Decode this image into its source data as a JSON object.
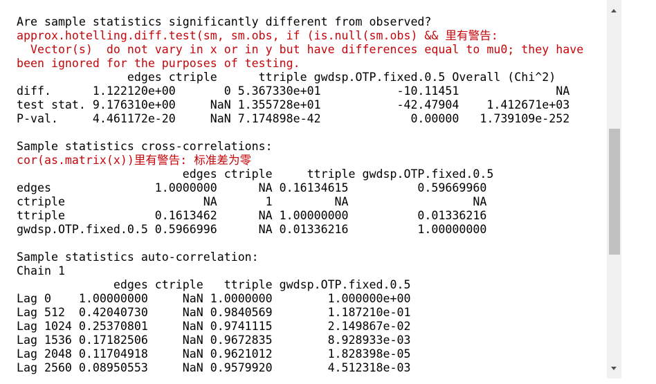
{
  "console": {
    "lines": [
      {
        "text": "Are sample statistics significantly different from observed?",
        "type": "output"
      },
      {
        "text": "approx.hotelling.diff.test(sm, sm.obs, if (is.null(sm.obs) && 里有警告:",
        "type": "error"
      },
      {
        "text": "  Vector(s)  do not vary in x or in y but have differences equal to mu0; they have",
        "type": "error"
      },
      {
        "text": "been ignored for the purposes of testing.",
        "type": "error"
      },
      {
        "text": "                edges ctriple      ttriple gwdsp.OTP.fixed.0.5 Overall (Chi^2)",
        "type": "output"
      },
      {
        "text": "diff.      1.122120e+00       0 5.367330e+01           -10.11451              NA",
        "type": "output"
      },
      {
        "text": "test stat. 9.176310e+00     NaN 1.355728e+01           -42.47904    1.412671e+03",
        "type": "output"
      },
      {
        "text": "P-val.     4.461172e-20     NaN 7.174898e-42             0.00000   1.739109e-252",
        "type": "output"
      },
      {
        "text": "",
        "type": "output"
      },
      {
        "text": "Sample statistics cross-correlations:",
        "type": "output"
      },
      {
        "text": "cor(as.matrix(x))里有警告: 标准差为零",
        "type": "error"
      },
      {
        "text": "                        edges ctriple     ttriple gwdsp.OTP.fixed.0.5",
        "type": "output"
      },
      {
        "text": "edges               1.0000000      NA 0.16134615          0.59669960",
        "type": "output"
      },
      {
        "text": "ctriple                    NA       1         NA                  NA",
        "type": "output"
      },
      {
        "text": "ttriple             0.1613462      NA 1.00000000          0.01336216",
        "type": "output"
      },
      {
        "text": "gwdsp.OTP.fixed.0.5 0.5966996      NA 0.01336216          1.00000000",
        "type": "output"
      },
      {
        "text": "",
        "type": "output"
      },
      {
        "text": "Sample statistics auto-correlation:",
        "type": "output"
      },
      {
        "text": "Chain 1",
        "type": "output"
      },
      {
        "text": "              edges ctriple   ttriple gwdsp.OTP.fixed.0.5",
        "type": "output"
      },
      {
        "text": "Lag 0    1.00000000     NaN 1.0000000        1.000000e+00",
        "type": "output"
      },
      {
        "text": "Lag 512  0.42040730     NaN 0.9840569        1.187210e-01",
        "type": "output"
      },
      {
        "text": "Lag 1024 0.25370801     NaN 0.9741115        2.149867e-02",
        "type": "output"
      },
      {
        "text": "Lag 1536 0.17182506     NaN 0.9672835        8.928933e-03",
        "type": "output"
      },
      {
        "text": "Lag 2048 0.11704918     NaN 0.9621012        1.828398e-05",
        "type": "output"
      },
      {
        "text": "Lag 2560 0.08950553     NaN 0.9579920        4.512318e-03",
        "type": "output"
      }
    ]
  },
  "scrollbar": {
    "position": 0.55,
    "up_icon": "scroll-up-arrow-icon",
    "down_icon": "scroll-down-arrow-icon"
  },
  "colors": {
    "output_text": "#000000",
    "error_text": "#c5060b",
    "background": "#ffffff",
    "scrollbar_track": "#f1f1f1",
    "scrollbar_thumb": "#c1c1c1"
  }
}
